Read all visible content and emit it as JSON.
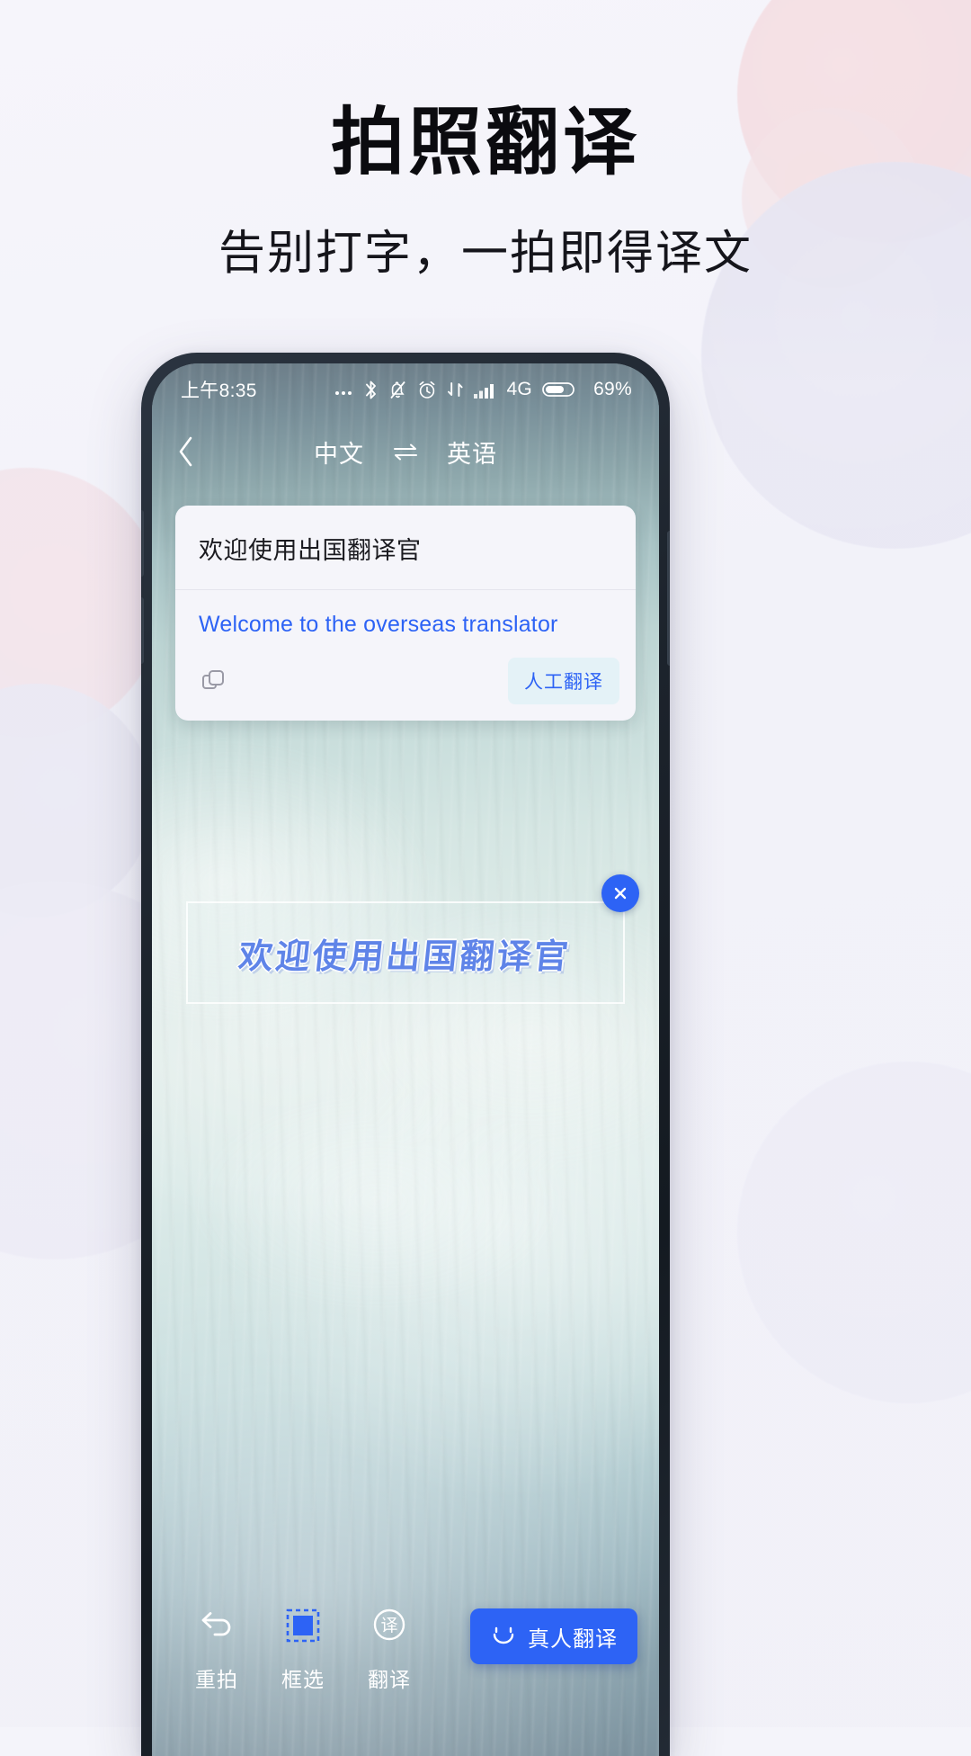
{
  "promo": {
    "title": "拍照翻译",
    "subtitle": "告别打字，一拍即得译文"
  },
  "phone": {
    "status_bar": {
      "time": "上午8:35",
      "icons": [
        "more-dots-icon",
        "bluetooth-icon",
        "bell-muted-icon",
        "alarm-clock-icon",
        "data-transfer-icon",
        "signal-bars-icon"
      ],
      "network": "4G",
      "battery_percent": "69%"
    },
    "nav": {
      "back_icon": "chevron-left-icon",
      "source_language": "中文",
      "swap_icon": "swap-horizontal-icon",
      "target_language": "英语"
    },
    "card": {
      "source_text": "欢迎使用出国翻译官",
      "target_text": "Welcome to the overseas translator",
      "copy_icon": "copy-icon",
      "human_translate_label": "人工翻译"
    },
    "ocr": {
      "detected_text": "欢迎使用出国翻译官",
      "close_icon": "close-circle-icon"
    },
    "toolbar": {
      "items": [
        {
          "icon": "undo-arrow-icon",
          "label": "重拍"
        },
        {
          "icon": "selection-box-icon",
          "label": "框选"
        },
        {
          "icon": "translate-circle-icon",
          "label": "翻译"
        }
      ],
      "primary_button": {
        "icon": "smiley-face-icon",
        "label": "真人翻译"
      }
    }
  },
  "colors": {
    "accent_blue": "#2d63f5",
    "ocr_blue": "#5f84e8",
    "card_bg": "#f5f5fa",
    "human_btn_bg": "#e4f2f7",
    "page_bg": "#f4f4fa"
  }
}
